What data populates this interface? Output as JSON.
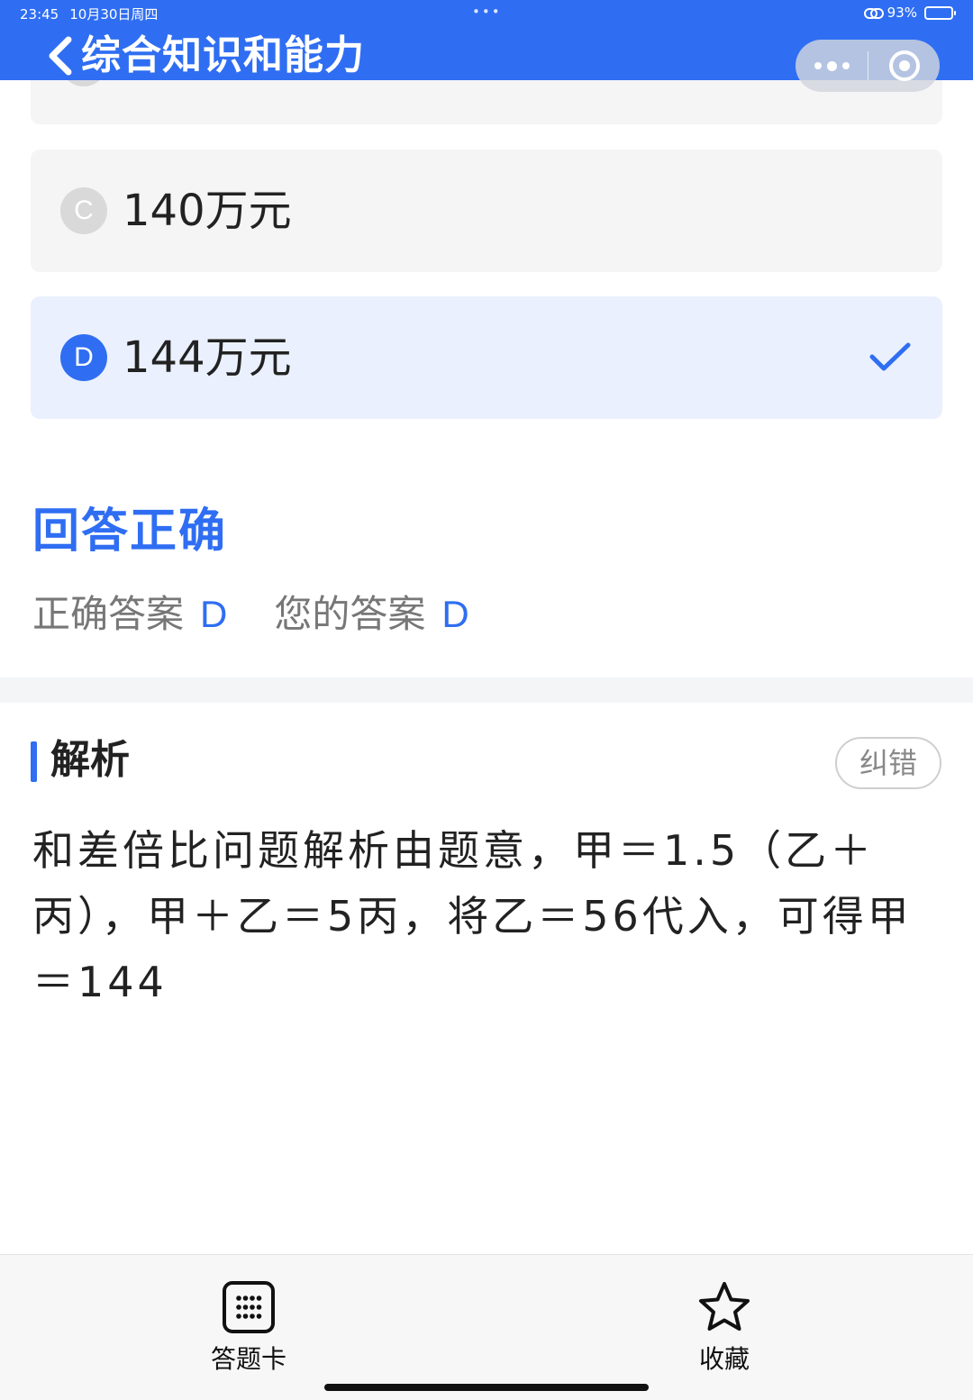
{
  "status_bar": {
    "time": "23:45",
    "date": "10月30日周四",
    "dots": "•••",
    "battery": "93%",
    "battery_level": 0.93
  },
  "header": {
    "title": "综合知识和能力"
  },
  "options": {
    "b": {
      "letter": "",
      "text": ""
    },
    "c": {
      "letter": "C",
      "text": "140万元"
    },
    "d": {
      "letter": "D",
      "text": "144万元",
      "selected": true
    }
  },
  "result": {
    "title": "回答正确",
    "correct_label": "正确答案",
    "correct_value": "D",
    "yours_label": "您的答案",
    "yours_value": "D"
  },
  "analysis": {
    "title": "解析",
    "report_label": "纠错",
    "body": "和差倍比问题解析由题意，甲＝1.5（乙＋丙），甲＋乙＝5丙，将乙＝56代入，可得甲＝144"
  },
  "bottom_bar": {
    "card_label": "答题卡",
    "favorite_label": "收藏"
  },
  "colors": {
    "accent": "#2f6ef2",
    "selected_bg": "#eaf0fe",
    "option_bg": "#f5f5f5"
  }
}
